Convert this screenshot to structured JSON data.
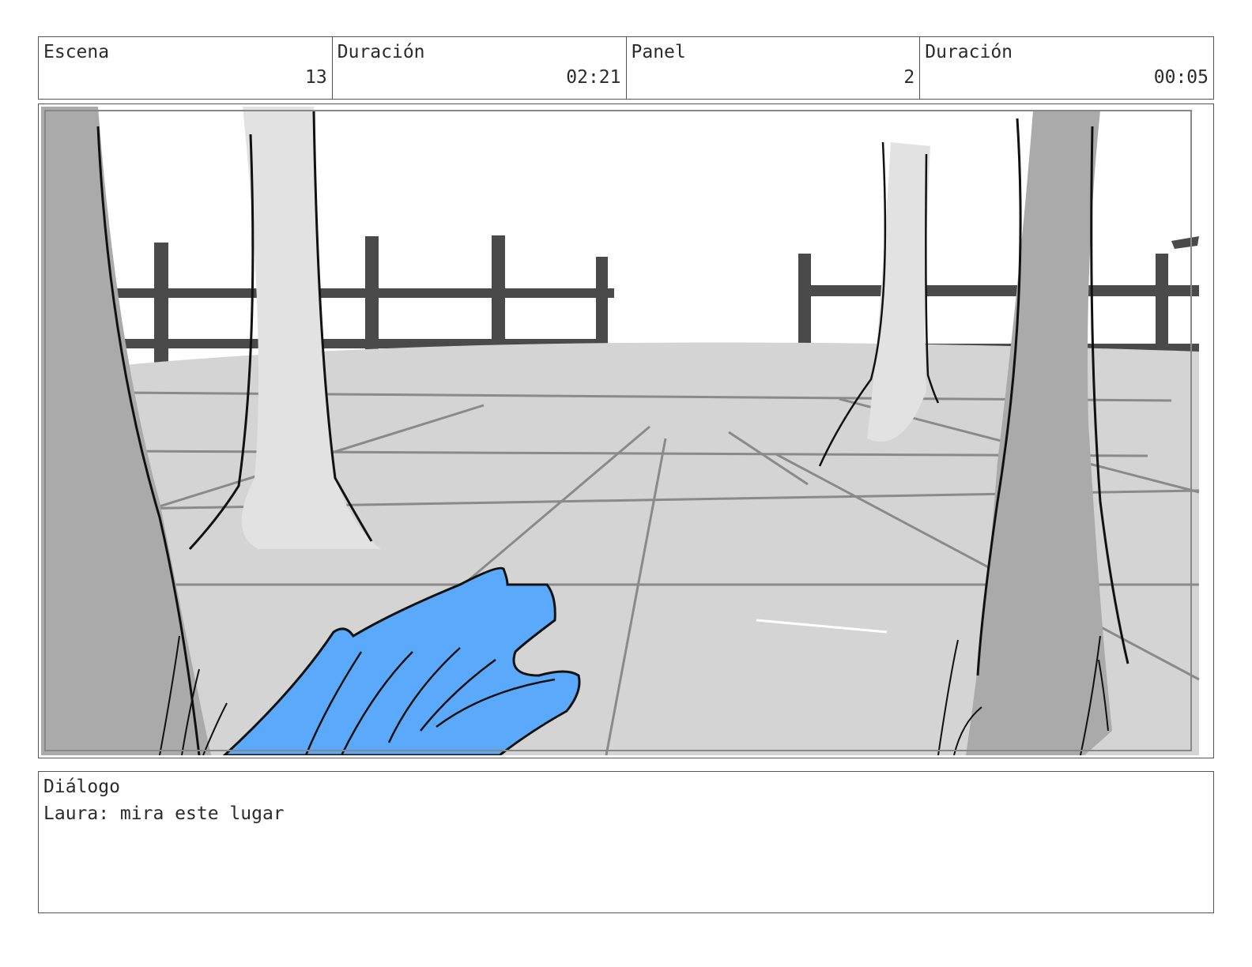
{
  "header": {
    "scene_label": "Escena",
    "scene_value": "13",
    "scene_duration_label": "Duración",
    "scene_duration_value": "02:21",
    "panel_label": "Panel",
    "panel_value": "2",
    "panel_duration_label": "Duración",
    "panel_duration_value": "00:05"
  },
  "dialog": {
    "label": "Diálogo",
    "text": "Laura: mira este lugar"
  },
  "colors": {
    "hand": "#5aa9fb",
    "ground": "#d4d4d4",
    "fence": "#4a4a4a",
    "trunk_dark": "#aaaaaa",
    "trunk_light": "#e2e2e2"
  }
}
